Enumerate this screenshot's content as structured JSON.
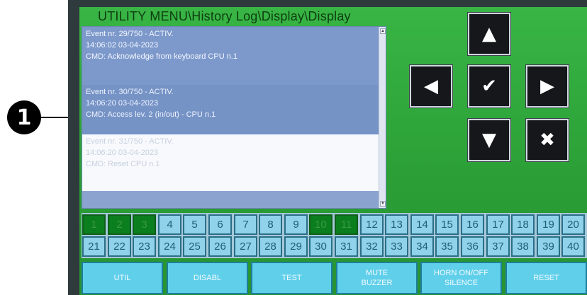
{
  "callout": {
    "number": "1"
  },
  "screen": {
    "title": "UTILITY MENU\\History Log\\Display\\Display"
  },
  "log": {
    "entries": [
      {
        "line1": "Event nr. 29/750 - ACTIV.",
        "line2": "14:06:02 03-04-2023",
        "line3": "CMD: Acknowledge from keyboard CPU n.1"
      },
      {
        "line1": "Event nr. 30/750 - ACTIV.",
        "line2": "14:06:20 03-04-2023",
        "line3": "CMD: Access lev. 2 (in/out) - CPU n.1"
      },
      {
        "line1": "Event nr. 31/750 - ACTIV.",
        "line2": "14:06:20 03-04-2023",
        "line3": "CMD: Reset CPU n.1"
      }
    ],
    "scroll_up_glyph": "▲",
    "scroll_down_glyph": "▼"
  },
  "nav": {
    "up": {
      "icon": "arrow-up-icon",
      "glyph": "▲"
    },
    "left": {
      "icon": "arrow-left-icon",
      "glyph": "◀"
    },
    "ok": {
      "icon": "checkmark-icon",
      "glyph": "✔"
    },
    "right": {
      "icon": "arrow-right-icon",
      "glyph": "▶"
    },
    "down": {
      "icon": "arrow-down-icon",
      "glyph": "▼"
    },
    "cancel": {
      "icon": "close-icon",
      "glyph": "✖"
    }
  },
  "zones": {
    "row1": [
      "1",
      "2",
      "3",
      "4",
      "5",
      "6",
      "7",
      "8",
      "9",
      "10",
      "11",
      "12",
      "13",
      "14",
      "15",
      "16",
      "17",
      "18",
      "19",
      "20"
    ],
    "row2": [
      "21",
      "22",
      "23",
      "24",
      "25",
      "26",
      "27",
      "28",
      "29",
      "30",
      "31",
      "32",
      "33",
      "34",
      "35",
      "36",
      "37",
      "38",
      "39",
      "40"
    ],
    "active": [
      "1",
      "2",
      "3",
      "10",
      "11"
    ],
    "colors": {
      "active": "#0b7e1d",
      "inactive": "#8fd2ea"
    }
  },
  "softkeys": [
    {
      "line1": "UTIL",
      "line2": ""
    },
    {
      "line1": "DISABL",
      "line2": ""
    },
    {
      "line1": "TEST",
      "line2": ""
    },
    {
      "line1": "MUTE",
      "line2": "BUZZER"
    },
    {
      "line1": "HORN ON/OFF",
      "line2": "SILENCE"
    },
    {
      "line1": "RESET",
      "line2": ""
    }
  ]
}
